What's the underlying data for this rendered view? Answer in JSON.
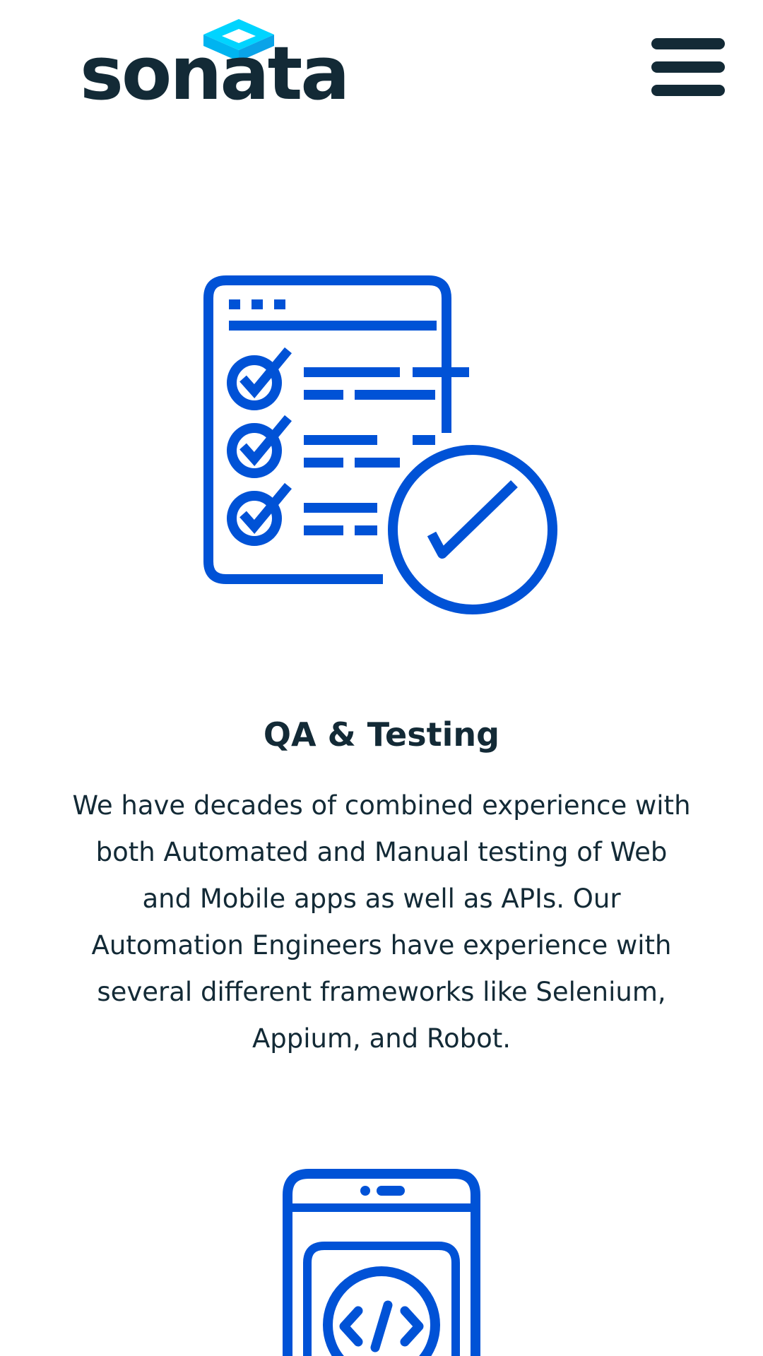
{
  "header": {
    "logo_text": "sonata",
    "menu_icon": "hamburger-menu-icon"
  },
  "colors": {
    "brand_dark": "#132a36",
    "accent_blue": "#0052d6",
    "logo_cyan": "#00d4ff",
    "logo_cyan_dark": "#0aa3e8",
    "background": "#ffffff"
  },
  "services": [
    {
      "icon": "qa-checklist-icon",
      "title": "QA & Testing",
      "description": "We have decades of combined experience with both Automated and Manual testing of Web and Mobile apps as well as APIs. Our Automation Engineers have experience with several different frameworks like Selenium, Appium, and Robot."
    },
    {
      "icon": "mobile-code-icon"
    }
  ]
}
